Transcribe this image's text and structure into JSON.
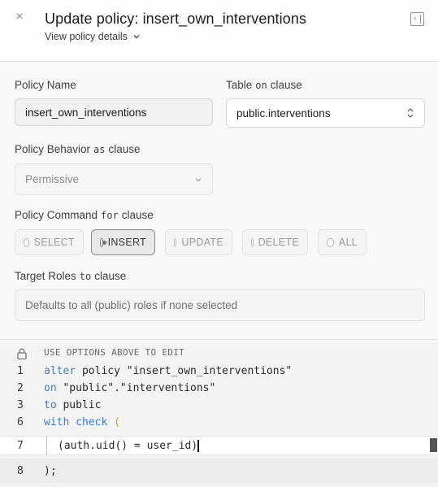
{
  "header": {
    "close_icon": "×",
    "title": "Update policy: insert_own_interventions",
    "view_details": "View policy details"
  },
  "form": {
    "policy_name_label": "Policy Name",
    "policy_name_value": "insert_own_interventions",
    "table_label": "Table",
    "table_kw": "on",
    "table_suffix": "clause",
    "table_value": "public.interventions",
    "behavior_label": "Policy Behavior",
    "behavior_kw": "as",
    "behavior_suffix": "clause",
    "behavior_value": "Permissive",
    "command_label": "Policy Command",
    "command_kw": "for",
    "command_suffix": "clause",
    "commands": [
      {
        "label": "SELECT",
        "selected": false
      },
      {
        "label": "INSERT",
        "selected": true
      },
      {
        "label": "UPDATE",
        "selected": false
      },
      {
        "label": "DELETE",
        "selected": false
      },
      {
        "label": "ALL",
        "selected": false
      }
    ],
    "roles_label": "Target Roles",
    "roles_kw": "to",
    "roles_suffix": "clause",
    "roles_placeholder": "Defaults to all (public) roles if none selected"
  },
  "editor": {
    "note": "USE OPTIONS ABOVE TO EDIT",
    "lines": [
      {
        "num": "1",
        "kw": "alter",
        "rest": " policy \"insert_own_interventions\""
      },
      {
        "num": "2",
        "kw": "on",
        "rest": " \"public\".\"interventions\""
      },
      {
        "num": "3",
        "kw": "to",
        "rest": " public"
      },
      {
        "num": "6",
        "kw": "with check",
        "rest": " ("
      },
      {
        "num": "7",
        "code": "(auth.uid() = user_id)"
      },
      {
        "num": "8",
        "code": ");"
      }
    ]
  },
  "colors": {
    "keyword": "#3a7bd5",
    "accent_border": "#8a8a8a"
  }
}
